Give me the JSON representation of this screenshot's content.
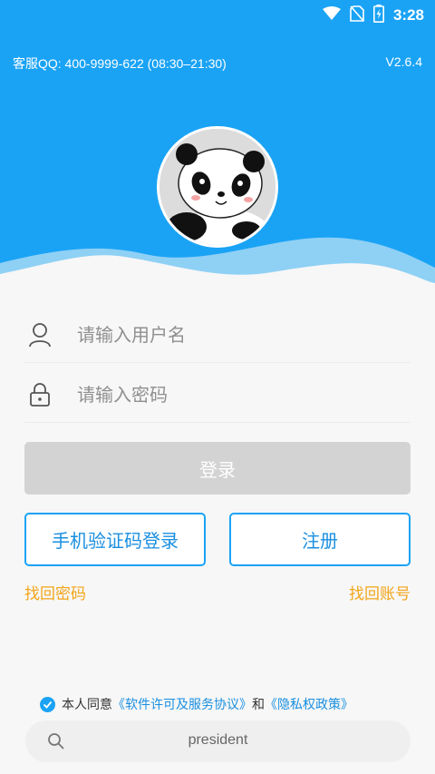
{
  "status_bar": {
    "time": "3:28"
  },
  "header": {
    "support": "客服QQ: 400-9999-622 (08:30–21:30)",
    "version": "V2.6.4",
    "avatar_icon": "panda-avatar-icon"
  },
  "form": {
    "username_placeholder": "请输入用户名",
    "password_placeholder": "请输入密码",
    "login_label": "登录",
    "sms_login_label": "手机验证码登录",
    "register_label": "注册",
    "forgot_password": "找回密码",
    "forgot_account": "找回账号"
  },
  "agreement": {
    "prefix": "本人同意",
    "license": "《软件许可及服务协议》",
    "and": "和",
    "privacy": "《隐私权政策》",
    "checked": true
  },
  "bottom_bar": {
    "text": "president"
  },
  "colors": {
    "primary": "#1aa3f5",
    "link_orange": "#f2a51a",
    "disabled": "#d3d3d3"
  }
}
